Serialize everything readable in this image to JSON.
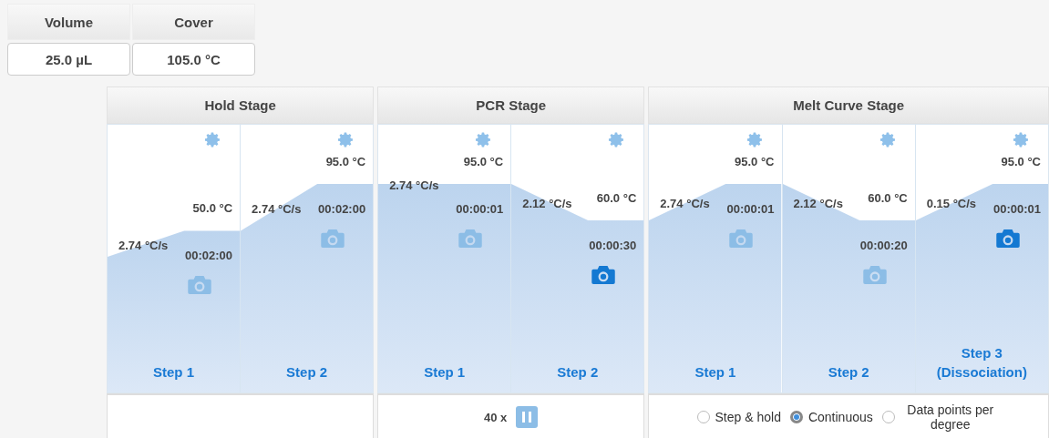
{
  "settings": [
    {
      "label": "Volume",
      "value": "25.0 µL"
    },
    {
      "label": "Cover",
      "value": "105.0 °C"
    }
  ],
  "stages": [
    {
      "title": "Hold Stage",
      "steps": [
        {
          "temperature": "50.0 °C",
          "rate": "2.74 °C/s",
          "time": "00:02:00",
          "collect": false,
          "label": "Step 1"
        },
        {
          "temperature": "95.0 °C",
          "rate": "2.74 °C/s",
          "time": "00:02:00",
          "collect": false,
          "label": "Step 2"
        }
      ],
      "footer": {
        "kind": "empty"
      }
    },
    {
      "title": "PCR Stage",
      "steps": [
        {
          "temperature": "95.0 °C",
          "rate": "2.74 °C/s",
          "time": "00:00:01",
          "collect": false,
          "label": "Step 1"
        },
        {
          "temperature": "60.0 °C",
          "rate": "2.12 °C/s",
          "time": "00:00:30",
          "collect": true,
          "label": "Step 2"
        }
      ],
      "footer": {
        "kind": "cycles",
        "count": "40 x"
      }
    },
    {
      "title": "Melt Curve Stage",
      "steps": [
        {
          "temperature": "95.0 °C",
          "rate": "2.74 °C/s",
          "time": "00:00:01",
          "collect": false,
          "label": "Step 1"
        },
        {
          "temperature": "60.0 °C",
          "rate": "2.12 °C/s",
          "time": "00:00:20",
          "collect": false,
          "label": "Step 2"
        },
        {
          "temperature": "95.0 °C",
          "rate": "0.15 °C/s",
          "time": "00:00:01",
          "collect": true,
          "label": "Step 3 (Dissociation)"
        }
      ],
      "footer": {
        "kind": "collection",
        "options": [
          {
            "label": "Step & hold",
            "selected": false
          },
          {
            "label": "Continuous",
            "selected": true
          },
          {
            "label": "Data points per degree",
            "selected": false
          }
        ]
      }
    }
  ]
}
